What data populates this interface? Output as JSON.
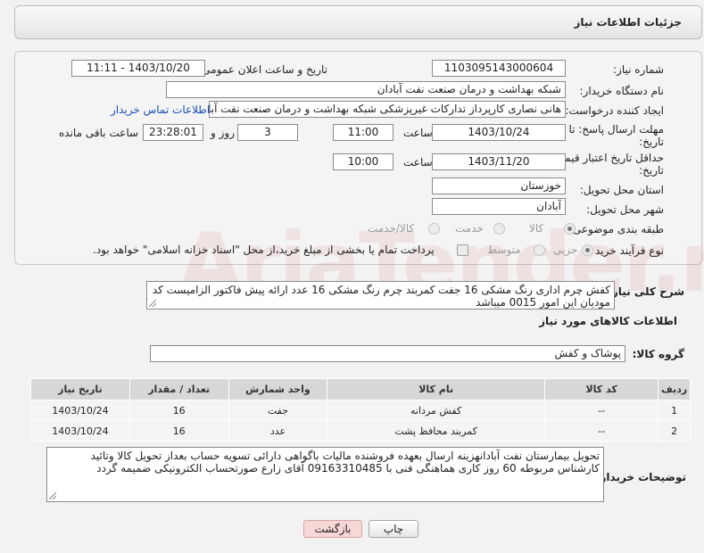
{
  "header": {
    "title": "جزئیات اطلاعات نیاز"
  },
  "form": {
    "need_number_label": "شماره نیاز:",
    "need_number": "1103095143000604",
    "announce_label": "تاریخ و ساعت اعلان عمومی:",
    "announce_value": "1403/10/20 - 11:11",
    "buyer_org_label": "نام دستگاه خریدار:",
    "buyer_org": "شبکه بهداشت و درمان صنعت نفت آبادان",
    "requester_label": "ایجاد کننده درخواست:",
    "requester": "هانی نصاری کارپرداز تدارکات غیرپزشکی شبکه بهداشت و درمان صنعت نفت آبادان",
    "contact_link": "اطلاعات تماس خریدار",
    "deadline_label": "مهلت ارسال پاسخ: تا تاریخ:",
    "deadline_date": "1403/10/24",
    "time_label": "ساعت",
    "deadline_time": "11:00",
    "days_value": "3",
    "days_label": "روز و",
    "remaining_time": "23:28:01",
    "remaining_label": "ساعت باقی مانده",
    "validity_label": "حداقل تاریخ اعتبار قیمت: تا تاریخ:",
    "validity_date": "1403/11/20",
    "validity_time": "10:00",
    "province_label": "استان محل تحویل:",
    "province": "خوزستان",
    "city_label": "شهر محل تحویل:",
    "city": "آبادان",
    "category_label": "طبقه بندی موضوعی:",
    "category_options": [
      "کالا",
      "خدمت",
      "کالا/خدمت"
    ],
    "process_label": "نوع فرآیند خرید :",
    "process_options": [
      "جزیی",
      "متوسط"
    ],
    "payment_note": "پرداخت تمام یا بخشی از مبلغ خرید،از محل \"اسناد خزانه اسلامی\" خواهد بود."
  },
  "description": {
    "label": "شرح کلی نیاز:",
    "text": "کفش چرم اداری رنگ مشکی 16 جفت کمربند چرم رنگ مشکی 16 عدد ارائه پیش فاکتور الزامیست کد مودیان این امور 0015 میباشد"
  },
  "goods": {
    "section_title": "اطلاعات کالاهای مورد نیاز",
    "group_label": "گروه کالا:",
    "group_value": "پوشاک و کفش",
    "columns": [
      "ردیف",
      "کد کالا",
      "نام کالا",
      "واحد شمارش",
      "تعداد / مقدار",
      "تاریخ نیاز"
    ],
    "rows": [
      {
        "row": "1",
        "code": "--",
        "name": "کفش مردانه",
        "unit": "جفت",
        "qty": "16",
        "date": "1403/10/24"
      },
      {
        "row": "2",
        "code": "--",
        "name": "کمربند محافظ پشت",
        "unit": "عدد",
        "qty": "16",
        "date": "1403/10/24"
      }
    ]
  },
  "buyer_notes": {
    "label": "توضیحات خریدار:",
    "text": "تحویل بیمارستان نفت آبادانهزینه ارسال بعهده فروشنده مالیات باگواهی دارائی تسویه حساب بعداز تحویل کالا وتائید کارشناس مربوطه 60 روز کاری هماهنگی فنی با 09163310485 آقای زارع صورتحساب الکترونیکی ضمیمه گردد"
  },
  "buttons": {
    "print": "چاپ",
    "back": "بازگشت"
  },
  "watermark": {
    "text": "AriaTender.neT"
  },
  "colors": {
    "link": "#1a4fb5",
    "back_button_bg": "#f8d7d7"
  }
}
